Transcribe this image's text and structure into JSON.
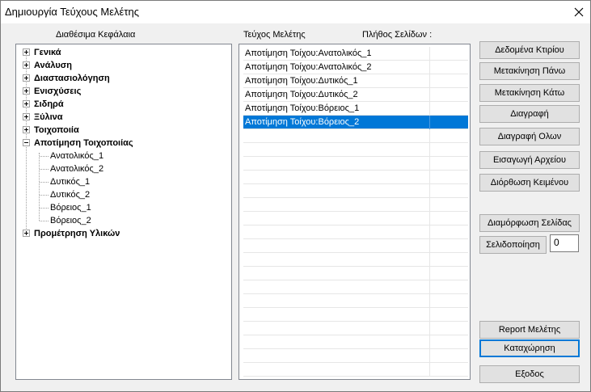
{
  "window": {
    "title": "Δημιουργία Τεύχους Μελέτης",
    "close_symbol": "✕"
  },
  "labels": {
    "available_chapters": "Διαθέσιμα Κεφάλαια",
    "study_volume": "Τεύχος Μελέτης",
    "page_count": "Πλήθος Σελίδων :"
  },
  "tree": {
    "top_nodes": [
      "Γενικά",
      "Ανάλυση",
      "Διαστασιολόγηση",
      "Ενισχύσεις",
      "Σιδηρά",
      "Ξύλινα",
      "Τοιχοποιία",
      "Αποτίμηση Τοιχοποιίας"
    ],
    "children": [
      "Ανατολικός_1",
      "Ανατολικός_2",
      "Δυτικός_1",
      "Δυτικός_2",
      "Βόρειος_1",
      "Βόρειος_2"
    ],
    "last_node": "Προμέτρηση Υλικών"
  },
  "volume_items": [
    "Αποτίμηση Τοίχου:Ανατολικός_1",
    "Αποτίμηση Τοίχου:Ανατολικός_2",
    "Αποτίμηση Τοίχου:Δυτικός_1",
    "Αποτίμηση Τοίχου:Δυτικός_2",
    "Αποτίμηση Τοίχου:Βόρειος_1",
    "Αποτίμηση Τοίχου:Βόρειος_2"
  ],
  "buttons": {
    "building_data": "Δεδομένα Κτιρίου",
    "move_up": "Μετακίνηση Πάνω",
    "move_down": "Μετακίνηση Κάτω",
    "delete": "Διαγραφή",
    "delete_all": "Διαγραφή Ολων",
    "import_file": "Εισαγωγή Αρχείου",
    "edit_text": "Διόρθωση Κειμένου",
    "page_setup": "Διαμόρφωση Σελίδας",
    "paginate": "Σελιδοποίηση",
    "report": "Report Μελέτης",
    "save": "Καταχώρηση",
    "exit": "Εξοδος"
  },
  "page_number_value": "0"
}
